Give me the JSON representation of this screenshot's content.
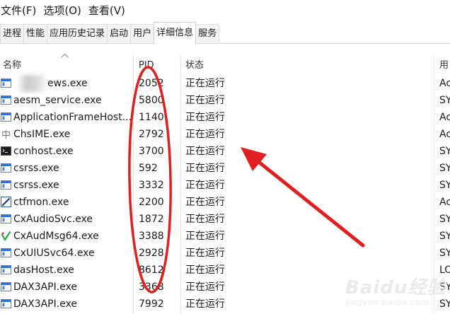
{
  "menubar": {
    "items": [
      "文件(F)",
      "选项(O)",
      "查看(V)"
    ]
  },
  "tabs": [
    {
      "label": "进程"
    },
    {
      "label": "性能"
    },
    {
      "label": "应用历史记录"
    },
    {
      "label": "启动"
    },
    {
      "label": "用户"
    },
    {
      "label": "详细信息",
      "active": true
    },
    {
      "label": "服务"
    }
  ],
  "table": {
    "sort_column": "名称",
    "columns": [
      "名称",
      "PID",
      "状态",
      "用"
    ],
    "rows": [
      {
        "name": "ews.exe",
        "pid": "2052",
        "status": "正在运行",
        "user": "Ac",
        "icon": "window-blue-icon",
        "name_blurred": true
      },
      {
        "name": "aesm_service.exe",
        "pid": "5800",
        "status": "正在运行",
        "user": "SY",
        "icon": "window-blue-icon"
      },
      {
        "name": "ApplicationFrameHost....",
        "pid": "1140",
        "status": "正在运行",
        "user": "Ac",
        "icon": "window-blue-icon"
      },
      {
        "name": "ChsIME.exe",
        "pid": "2792",
        "status": "正在运行",
        "user": "Ac",
        "icon": "chinese-ime-icon"
      },
      {
        "name": "conhost.exe",
        "pid": "3700",
        "status": "正在运行",
        "user": "SY",
        "icon": "console-icon"
      },
      {
        "name": "csrss.exe",
        "pid": "592",
        "status": "正在运行",
        "user": "SY",
        "icon": "window-blue-icon"
      },
      {
        "name": "csrss.exe",
        "pid": "3332",
        "status": "正在运行",
        "user": "SY",
        "icon": "window-blue-icon"
      },
      {
        "name": "ctfmon.exe",
        "pid": "2200",
        "status": "正在运行",
        "user": "Ac",
        "icon": "pen-icon"
      },
      {
        "name": "CxAudioSvc.exe",
        "pid": "1872",
        "status": "正在运行",
        "user": "SY",
        "icon": "window-blue-icon"
      },
      {
        "name": "CxAudMsg64.exe",
        "pid": "3388",
        "status": "正在运行",
        "user": "SY",
        "icon": "audio-check-icon"
      },
      {
        "name": "CxUIUSvc64.exe",
        "pid": "2928",
        "status": "正在运行",
        "user": "SY",
        "icon": "window-blue-icon"
      },
      {
        "name": "dasHost.exe",
        "pid": "8612",
        "status": "正在运行",
        "user": "LO",
        "icon": "window-blue-icon"
      },
      {
        "name": "DAX3API.exe",
        "pid": "3368",
        "status": "正在运行",
        "user": "SY",
        "icon": "window-blue-icon"
      },
      {
        "name": "DAX3API.exe",
        "pid": "7992",
        "status": "正在运行",
        "user": "SY",
        "icon": "window-blue-icon"
      }
    ]
  },
  "annotation": {
    "color": "#e02020",
    "shapes": [
      "ellipse-around-pid-column",
      "arrow-pointing-to-pid-column"
    ]
  },
  "watermark": {
    "text": "Baidu经验",
    "subtext": "jingyan.baidu.com"
  }
}
